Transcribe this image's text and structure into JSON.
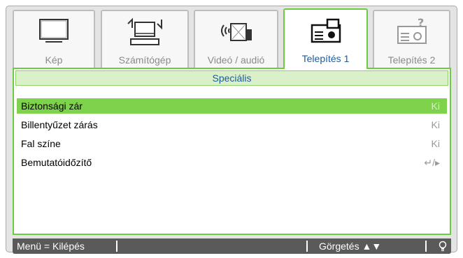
{
  "tabs": [
    {
      "label": "Kép",
      "icon": "monitor-icon"
    },
    {
      "label": "Számítógép",
      "icon": "computer-icon"
    },
    {
      "label": "Videó / audió",
      "icon": "video-audio-icon"
    },
    {
      "label": "Telepítés 1",
      "icon": "projector-setup-icon",
      "active": true
    },
    {
      "label": "Telepítés 2",
      "icon": "projector-help-icon"
    }
  ],
  "section": {
    "title": "Speciális"
  },
  "menu": [
    {
      "label": "Biztonsági zár",
      "value": "Ki",
      "selected": true
    },
    {
      "label": "Billentyűzet zárás",
      "value": "Ki"
    },
    {
      "label": "Fal színe",
      "value": "Ki"
    },
    {
      "label": "Bemutatóidőzítő",
      "value": "↵/▸",
      "icon": "enter-arrow-icon"
    }
  ],
  "status": {
    "menu_exit": "Menü = Kilépés",
    "scroll": "Görgetés ▲▼",
    "help_icon": "lightbulb-icon"
  },
  "colors": {
    "accent_green": "#6ccb3e",
    "selected_row": "#7fd24c",
    "section_bg": "#d9f0c8",
    "label_blue": "#1f5a99",
    "status_bar": "#5a5a5a"
  }
}
